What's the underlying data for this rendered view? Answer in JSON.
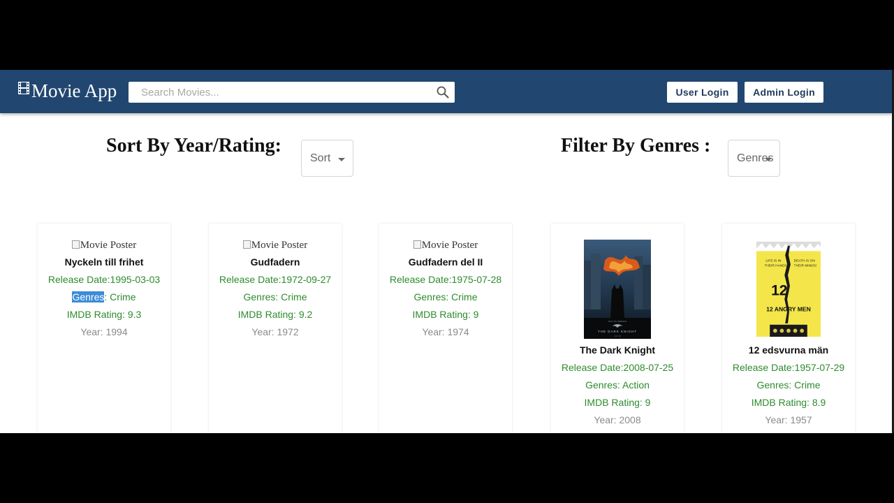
{
  "navbar": {
    "brand": "Movie App",
    "search_placeholder": "Search Movies...",
    "user_login": "User Login",
    "admin_login": "Admin Login"
  },
  "controls": {
    "sort_label": "Sort By Year/Rating:",
    "sort_value": "Sort",
    "genre_label": "Filter By Genres :",
    "genre_value": "Genres"
  },
  "movies": [
    {
      "poster_alt": "Movie Poster",
      "title": "Nyckeln till frihet",
      "release": "Release Date:1995-03-03",
      "genres_prefix": "Genres",
      "genres_rest": ": Crime",
      "rating": "IMDB Rating: 9.3",
      "year": "Year: 1994"
    },
    {
      "poster_alt": "Movie Poster",
      "title": "Gudfadern",
      "release": "Release Date:1972-09-27",
      "genres": "Genres: Crime",
      "rating": "IMDB Rating: 9.2",
      "year": "Year: 1972"
    },
    {
      "poster_alt": "Movie Poster",
      "title": "Gudfadern del II",
      "release": "Release Date:1975-07-28",
      "genres": "Genres: Crime",
      "rating": "IMDB Rating: 9",
      "year": "Year: 1974"
    },
    {
      "poster_text": "THE DARK KNIGHT",
      "title": "The Dark Knight",
      "release": "Release Date:2008-07-25",
      "genres": "Genres: Action",
      "rating": "IMDB Rating: 9",
      "year": "Year: 2008"
    },
    {
      "poster_text": "12 ANGRY MEN",
      "title": "12 edsvurna män",
      "release": "Release Date:1957-07-29",
      "genres": "Genres: Crime",
      "rating": "IMDB Rating: 8.9",
      "year": "Year: 1957"
    }
  ],
  "colors": {
    "navbar": "#214770",
    "meta_green": "#2e8b2e",
    "year_gray": "#8a8a8a",
    "selection": "#3d8cd8"
  }
}
